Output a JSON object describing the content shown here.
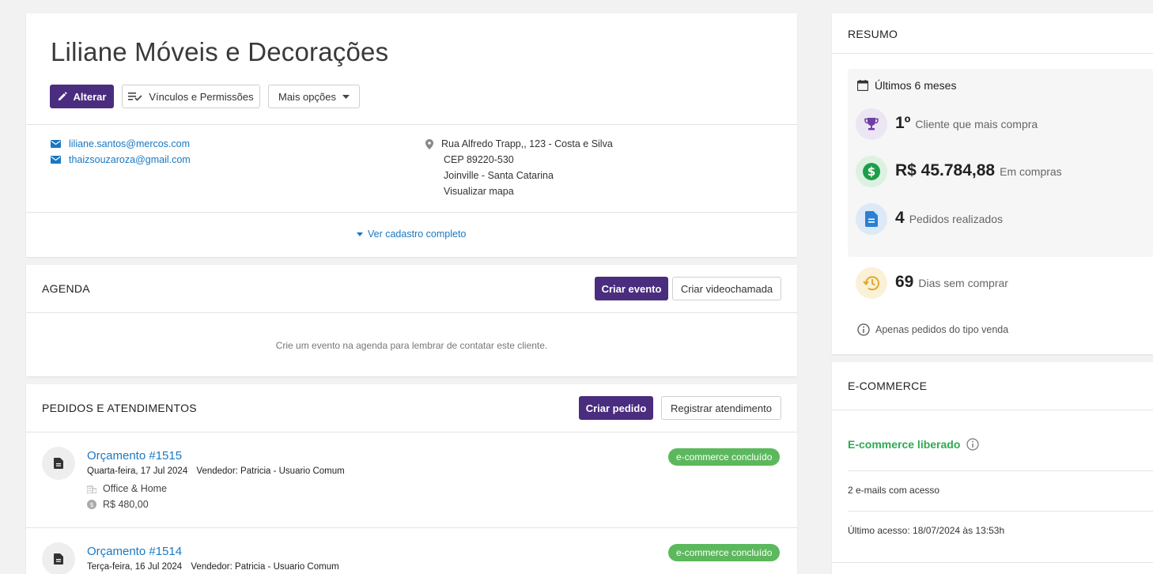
{
  "client": {
    "name": "Liliane Móveis e Decorações",
    "btn_alterar": "Alterar",
    "btn_vinculos": "Vínculos e Permissões",
    "btn_mais": "Mais opções",
    "emails": [
      "liliane.santos@mercos.com",
      "thaizsouzaroza@gmail.com"
    ],
    "address": {
      "street": "Rua Alfredo Trapp,, 123 - Costa e Silva",
      "cep": "CEP 89220-530",
      "city": "Joinville - Santa Catarina",
      "map_link": "Visualizar mapa"
    },
    "ver_cadastro": "Ver cadastro completo"
  },
  "agenda": {
    "title": "AGENDA",
    "btn_criar_evento": "Criar evento",
    "btn_videochamada": "Criar videochamada",
    "empty_text": "Crie um evento na agenda para lembrar de contatar este cliente."
  },
  "pedidos": {
    "title": "PEDIDOS E ATENDIMENTOS",
    "btn_criar_pedido": "Criar pedido",
    "btn_registrar": "Registrar atendimento",
    "items": [
      {
        "title": "Orçamento #1515",
        "date": "Quarta-feira, 17 Jul 2024",
        "vendor": "Vendedor: Patricia - Usuario Comum",
        "badge": "e-commerce concluído",
        "company": "Office & Home",
        "value": "R$ 480,00"
      },
      {
        "title": "Orçamento #1514",
        "date": "Terça-feira, 16 Jul 2024",
        "vendor": "Vendedor: Patricia - Usuario Comum",
        "badge": "e-commerce concluído"
      }
    ]
  },
  "resumo": {
    "title": "RESUMO",
    "period": "Últimos 6 meses",
    "rank_big": "1º",
    "rank_label": "Cliente que mais compra",
    "total_big": "R$ 45.784,88",
    "total_label": "Em compras",
    "orders_big": "4",
    "orders_label": "Pedidos realizados",
    "days_big": "69",
    "days_label": "Dias sem comprar",
    "note": "Apenas pedidos do tipo venda"
  },
  "ecommerce": {
    "title": "E-COMMERCE",
    "status": "E-commerce liberado",
    "emails_access": "2 e-mails com acesso",
    "last_access": "Último acesso: 18/07/2024 às 13:53h"
  },
  "colors": {
    "primary": "#4a2d7e",
    "link": "#1a78c2",
    "badge_green": "#5cb85c",
    "ecommerce_green": "#2dab4f"
  }
}
